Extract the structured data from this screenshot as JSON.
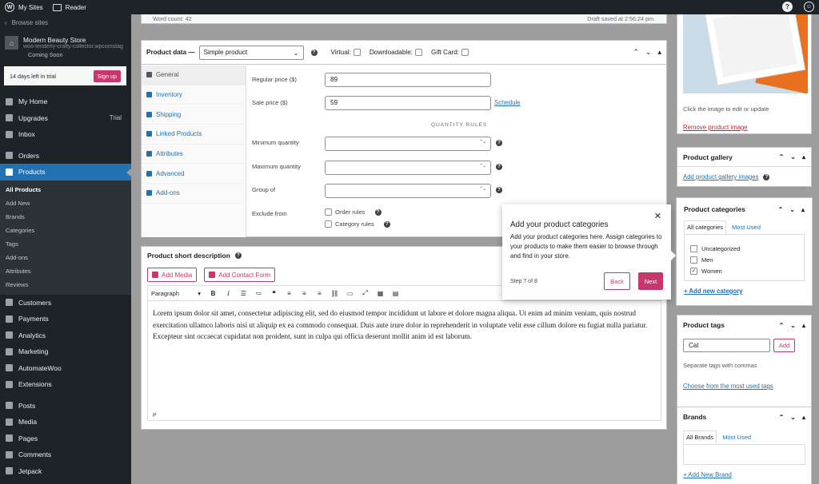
{
  "topbar": {
    "my_sites": "My Sites",
    "reader": "Reader"
  },
  "sidebar": {
    "browse": "Browse sites",
    "site_name": "Modern Beauty Store",
    "site_url": "woo-tenderly-crafty-collector.wpcomstaging.com",
    "coming_soon": "Coming Soon",
    "trial_text": "14 days left in trial",
    "signup": "Sign up",
    "home": "My Home",
    "upgrades": "Upgrades",
    "upgrades_badge": "Trial",
    "inbox": "Inbox",
    "orders": "Orders",
    "products": "Products",
    "submenu": [
      "All Products",
      "Add New",
      "Brands",
      "Categories",
      "Tags",
      "Add-ons",
      "Attributes",
      "Reviews"
    ],
    "customers": "Customers",
    "payments": "Payments",
    "analytics": "Analytics",
    "marketing": "Marketing",
    "automatewoo": "AutomateWoo",
    "extensions": "Extensions",
    "posts": "Posts",
    "media": "Media",
    "pages": "Pages",
    "comments": "Comments",
    "jetpack": "Jetpack"
  },
  "wordcount": {
    "count": "Word count: 42",
    "draft": "Draft saved at 2:56:24 pm."
  },
  "product_data": {
    "title": "Product data —",
    "type": "Simple product",
    "virtual": "Virtual:",
    "downloadable": "Downloadable:",
    "gift_card": "Gift Card:",
    "tabs": [
      "General",
      "Inventory",
      "Shipping",
      "Linked Products",
      "Attributes",
      "Advanced",
      "Add-ons"
    ],
    "regular_price_label": "Regular price ($)",
    "regular_price": "89",
    "sale_price_label": "Sale price ($)",
    "sale_price": "59",
    "schedule": "Schedule",
    "quantity_rules": "QUANTITY RULES",
    "min_qty": "Minimum quantity",
    "max_qty": "Maximum quantity",
    "group_of": "Group of",
    "exclude_from": "Exclude from",
    "order_rules": "Order rules",
    "category_rules": "Category rules"
  },
  "short_desc": {
    "title": "Product short description",
    "add_media": "Add Media",
    "add_contact": "Add Contact Form",
    "paragraph": "Paragraph",
    "content": "Lorem ipsum dolor sit amet, consectetur adipiscing elit, sed do eiusmod tempor incididunt ut labore et dolore magna aliqua. Ut enim ad minim veniam, quis nostrud exercitation ullamco laboris nisi ut aliquip ex ea commodo consequat. Duis aute irure dolor in reprehenderit in voluptate velit esse cillum dolore eu fugiat nulla pariatur. Excepteur sint occaecat cupidatat non proident, sunt in culpa qui officia deserunt mollit anim id est laborum.",
    "path": "P"
  },
  "product_image": {
    "hint": "Click the image to edit or update",
    "remove": "Remove product image"
  },
  "gallery": {
    "title": "Product gallery",
    "add": "Add product gallery images"
  },
  "categories": {
    "title": "Product categories",
    "tab_all": "All categories",
    "tab_used": "Most Used",
    "items": [
      {
        "label": "Uncategorized",
        "checked": ""
      },
      {
        "label": "Men",
        "checked": ""
      },
      {
        "label": "Women",
        "checked": "✓"
      }
    ],
    "add_new": "+ Add new category"
  },
  "tags": {
    "title": "Product tags",
    "value": "Cat",
    "add": "Add",
    "hint": "Separate tags with commas",
    "choose": "Choose from the most used tags"
  },
  "brands": {
    "title": "Brands",
    "tab_all": "All Brands",
    "tab_used": "Most Used",
    "add_new": "+ Add New Brand"
  },
  "tour": {
    "title": "Add your product categories",
    "body": "Add your product categories here. Assign categories to your products to make them easier to browse through and find in your store.",
    "step": "Step 7 of 8",
    "back": "Back",
    "next": "Next"
  }
}
